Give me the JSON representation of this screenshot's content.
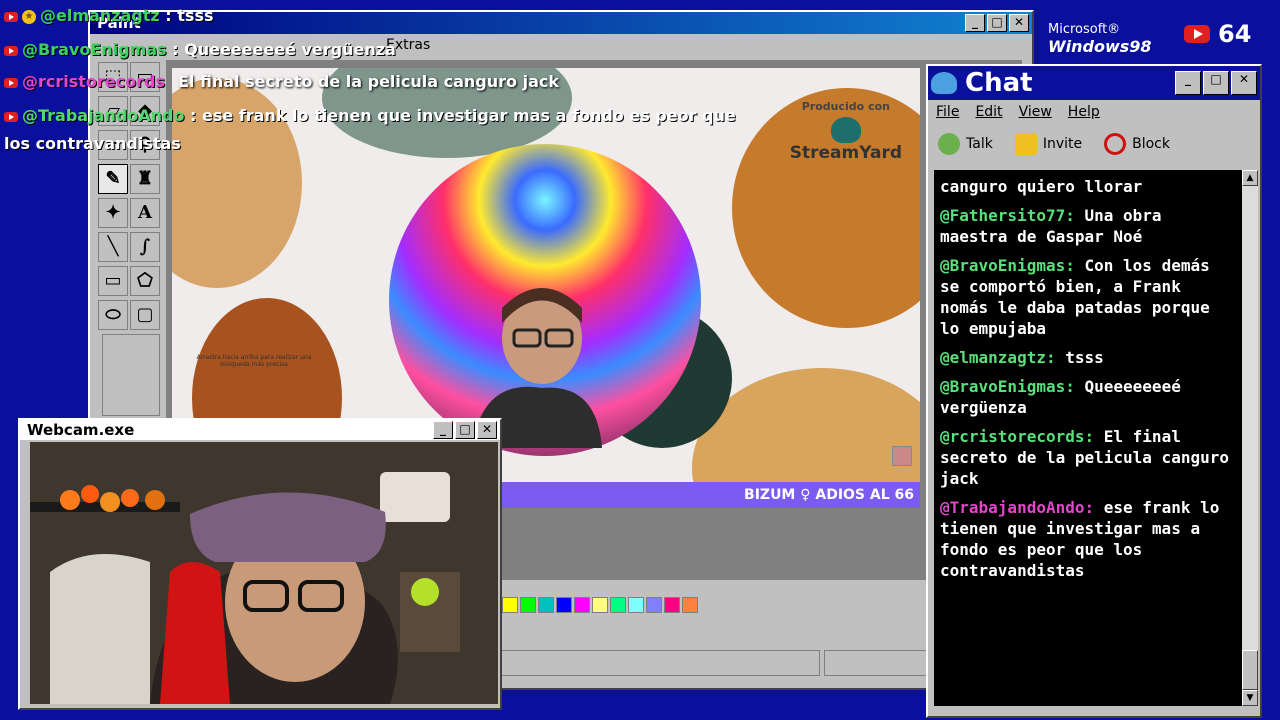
{
  "paint": {
    "title": "Paint",
    "menu": [
      "Extras"
    ],
    "palette": [
      "#ffff00",
      "#00ff00",
      "#00c0c0",
      "#0000ff",
      "#ff00ff",
      "#ffff80",
      "#00ff80",
      "#80ffff",
      "#8080ff",
      "#ff0080",
      "#ff8040"
    ]
  },
  "overlay_chat": [
    {
      "user": "@elmanzagtz",
      "sep": " : ",
      "text": "tsss"
    },
    {
      "user": "@BravoEnigmas",
      "sep": " : ",
      "text": "Queeeeeeeé vergüenza"
    },
    {
      "user": "@rcristorecords",
      "sep": "",
      "text": ""
    },
    {
      "user": "@TrabajandoAndo",
      "sep": " : ",
      "text": "ese frank lo tienen que investigar mas a fondo es peor que"
    },
    {
      "user": "",
      "sep": "",
      "text": "los contravandistas"
    }
  ],
  "stream": {
    "title": "El final secreto de la pelicula canguro jack",
    "produced_by": "Producido con",
    "brand": "StreamYard",
    "hint": "Arrastra hacia arriba para realizar una búsqueda más precisa",
    "banner": "BIZUM ♀ ADIOS AL 66"
  },
  "webcam": {
    "title": "Webcam.exe"
  },
  "chat": {
    "title": "Chat",
    "menu": [
      "File",
      "Edit",
      "View",
      "Help"
    ],
    "toolbar": [
      "Talk",
      "Invite",
      "Block"
    ],
    "messages": [
      {
        "user": "",
        "text": "canguro quiero llorar"
      },
      {
        "user": "@Fathersito77:",
        "text": "Una obra maestra de Gaspar Noé"
      },
      {
        "user": "@BravoEnigmas:",
        "text": "Con los demás se comportó bien, a Frank nomás le daba patadas porque lo empujaba"
      },
      {
        "user": "@elmanzagtz:",
        "text": "tsss"
      },
      {
        "user": "@BravoEnigmas:",
        "text": "Queeeeeeeé vergüenza"
      },
      {
        "user": "@rcristorecords:",
        "text": "El final secreto de la pelicula canguro jack"
      },
      {
        "user": "@TrabajandoAndo:",
        "text": "ese frank lo tienen que investigar mas a fondo es peor que los contravandistas"
      }
    ]
  },
  "branding": {
    "microsoft": "Microsoft®",
    "windows": "Windows98"
  },
  "viewer_count": "64"
}
